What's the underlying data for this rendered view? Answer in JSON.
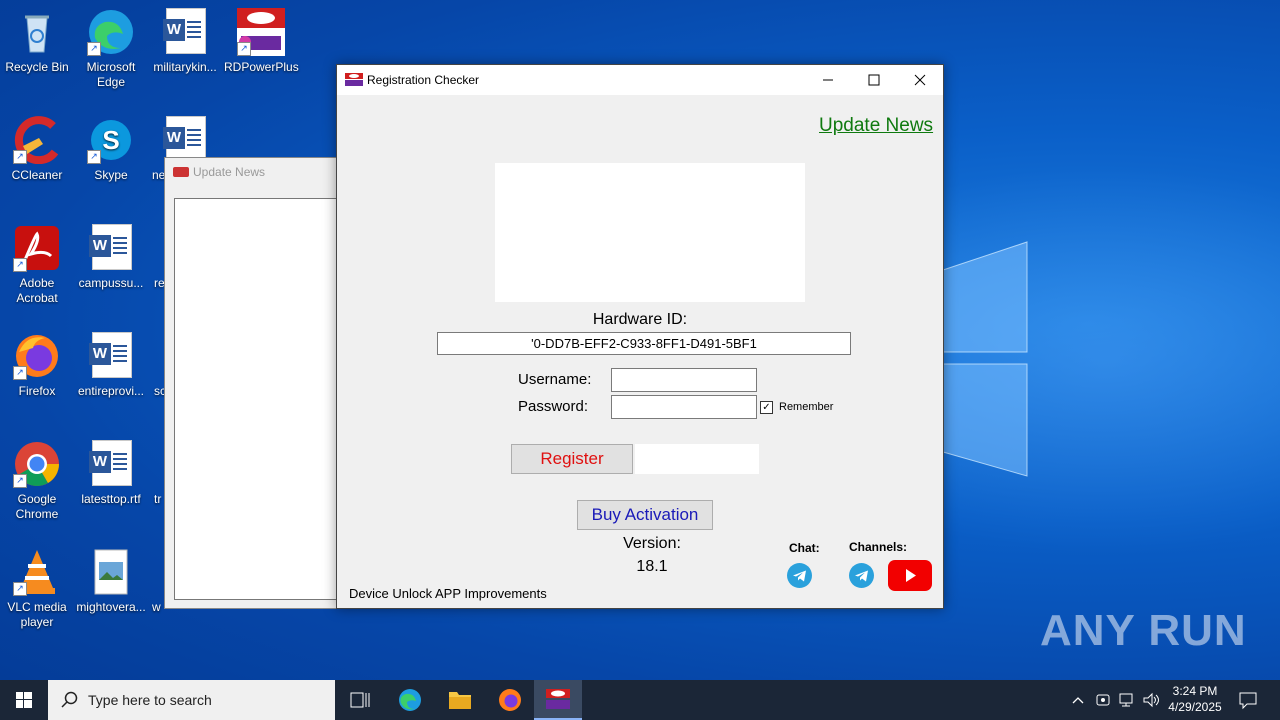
{
  "desktop": {
    "icons": [
      {
        "label": "Recycle Bin"
      },
      {
        "label": "Microsoft Edge"
      },
      {
        "label": "militarykin..."
      },
      {
        "label": "RDPowerPlus"
      },
      {
        "label": "CCleaner"
      },
      {
        "label": "Skype"
      },
      {
        "label": "ne"
      },
      {
        "label": "Adobe Acrobat"
      },
      {
        "label": "campussu..."
      },
      {
        "label": "re"
      },
      {
        "label": "Firefox"
      },
      {
        "label": "entireprovi..."
      },
      {
        "label": "sc"
      },
      {
        "label": "Google Chrome"
      },
      {
        "label": "latesttop.rtf"
      },
      {
        "label": "tr"
      },
      {
        "label": "VLC media player"
      },
      {
        "label": "mightovera..."
      },
      {
        "label": "w"
      }
    ]
  },
  "news_window": {
    "title": "Update News"
  },
  "main_window": {
    "title": "Registration Checker",
    "update_news_link": "Update News",
    "hardware_id_label": "Hardware ID:",
    "hardware_id_value": "'0-DD7B-EFF2-C933-8FF1-D491-5BF1",
    "username_label": "Username:",
    "username_value": "",
    "password_label": "Password:",
    "password_value": "",
    "remember_label": "Remember",
    "remember_checked": true,
    "register_button": "Register",
    "buy_button": "Buy Activation",
    "version_label": "Version:",
    "version_value": "18.1",
    "chat_label": "Chat:",
    "channels_label": "Channels:",
    "footer_text": "Device Unlock APP Improvements"
  },
  "watermark": "ANY RUN",
  "taskbar": {
    "search_placeholder": "Type here to search",
    "time": "3:24 PM",
    "date": "4/29/2025"
  }
}
